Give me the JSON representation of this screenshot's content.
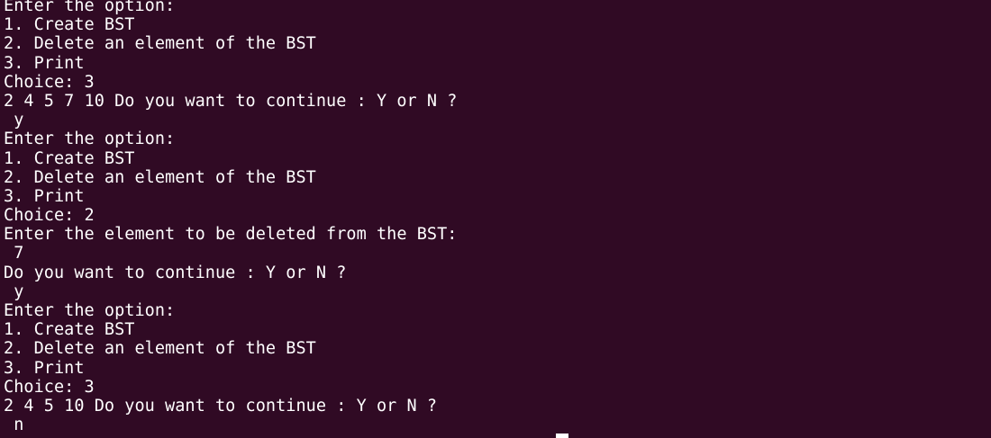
{
  "terminal": {
    "lines": [
      "Enter the option:",
      "1. Create BST",
      "2. Delete an element of the BST",
      "3. Print",
      "Choice: 3",
      "2 4 5 7 10 Do you want to continue : Y or N ?",
      " y",
      "Enter the option:",
      "1. Create BST",
      "2. Delete an element of the BST",
      "3. Print",
      "Choice: 2",
      "Enter the element to be deleted from the BST:",
      " 7",
      "Do you want to continue : Y or N ?",
      " y",
      "Enter the option:",
      "1. Create BST",
      "2. Delete an element of the BST",
      "3. Print",
      "Choice: 3",
      "2 4 5 10 Do you want to continue : Y or N ?",
      " n"
    ],
    "colors": {
      "background": "#300a24",
      "foreground": "#ffffff"
    }
  }
}
